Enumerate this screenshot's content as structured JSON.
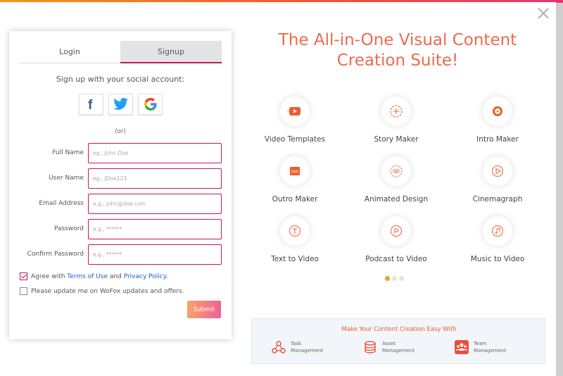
{
  "tabs": {
    "login": "Login",
    "signup": "Signup"
  },
  "social": {
    "title": "Sign up with your social account:",
    "buttons": [
      "facebook",
      "twitter",
      "google"
    ],
    "or_text": "(or)"
  },
  "fields": {
    "full_name": {
      "label": "Full Name",
      "placeholder": "eg., John Doe"
    },
    "user_name": {
      "label": "User Name",
      "placeholder": "eg., JDoe123"
    },
    "email": {
      "label": "Email Address",
      "placeholder": "e.g., john@doe.com"
    },
    "password": {
      "label": "Password",
      "placeholder": "e.g., ******"
    },
    "confirm": {
      "label": "Confirm Password",
      "placeholder": "e.g., ******"
    }
  },
  "agree": {
    "prefix": "Agree with",
    "terms": "Terms of Use",
    "and": "and",
    "privacy": "Privacy Policy",
    "suffix": ".",
    "checked": true
  },
  "updates": {
    "label": "Please update me on WoFox updates and offers.",
    "checked": false
  },
  "submit_label": "Submit",
  "headline": "The All-in-One Visual Content Creation Suite!",
  "features": [
    {
      "label": "Video Templates",
      "icon": "video-templates-icon"
    },
    {
      "label": "Story Maker",
      "icon": "story-maker-icon"
    },
    {
      "label": "Intro Maker",
      "icon": "intro-maker-icon"
    },
    {
      "label": "Outro Maker",
      "icon": "outro-maker-icon"
    },
    {
      "label": "Animated Design",
      "icon": "animated-design-icon"
    },
    {
      "label": "Cinemagraph",
      "icon": "cinemagraph-icon"
    },
    {
      "label": "Text to Video",
      "icon": "text-to-video-icon"
    },
    {
      "label": "Podcast to Video",
      "icon": "podcast-to-video-icon"
    },
    {
      "label": "Music to Video",
      "icon": "music-to-video-icon"
    }
  ],
  "carousel": {
    "pages": 3,
    "active": 0
  },
  "bottom_panel": {
    "title": "Make Your Content Creation Easy With",
    "items": [
      {
        "line1": "Task",
        "line2": "Management",
        "icon": "task-management-icon"
      },
      {
        "line1": "Asset",
        "line2": "Management",
        "icon": "asset-management-icon"
      },
      {
        "line1": "Team",
        "line2": "Management",
        "icon": "team-management-icon"
      }
    ]
  },
  "colors": {
    "accent": "#c2185b",
    "headline": "#ef6a4c",
    "facebook": "#3b5998",
    "twitter": "#1da1f2",
    "dot_active": "#f0a030"
  }
}
